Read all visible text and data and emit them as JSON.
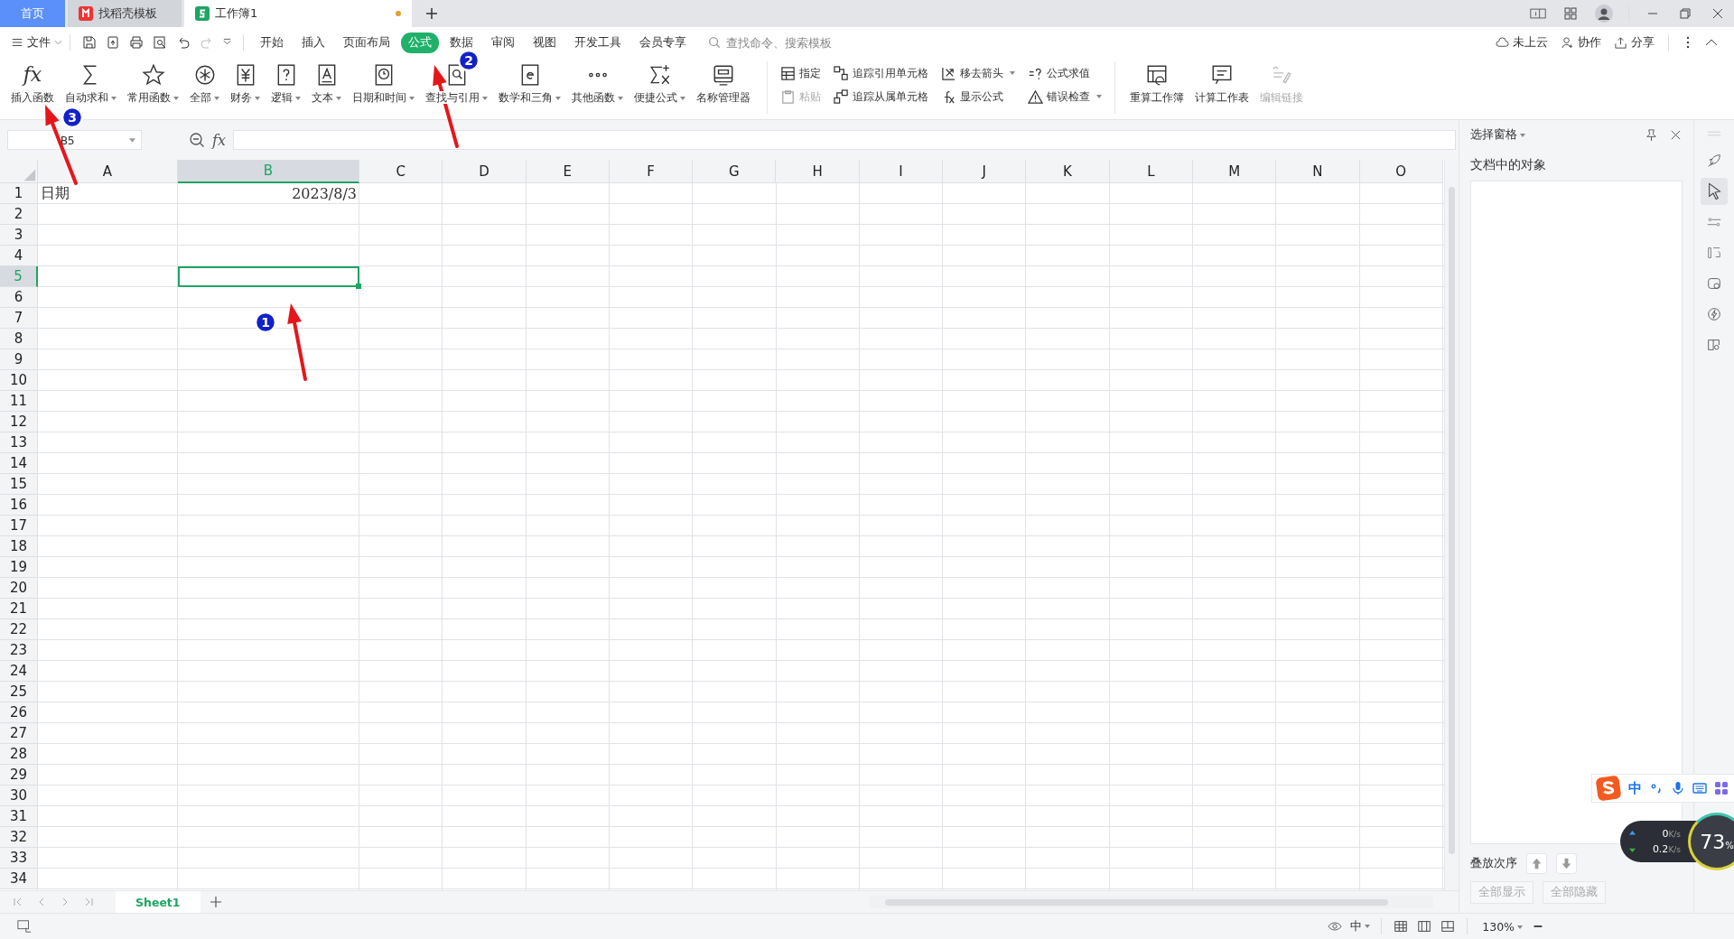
{
  "tabs": [
    {
      "label": "首页",
      "kind": "home",
      "selected": false,
      "modified": false
    },
    {
      "label": "找稻壳模板",
      "kind": "docer",
      "selected": false,
      "modified": false
    },
    {
      "label": "工作簿1",
      "kind": "sheet",
      "selected": true,
      "modified": true
    }
  ],
  "menu": {
    "file": "文件",
    "tabs": [
      {
        "label": "开始",
        "selected": false
      },
      {
        "label": "插入",
        "selected": false
      },
      {
        "label": "页面布局",
        "selected": false
      },
      {
        "label": "公式",
        "selected": true
      },
      {
        "label": "数据",
        "selected": false
      },
      {
        "label": "审阅",
        "selected": false
      },
      {
        "label": "视图",
        "selected": false
      },
      {
        "label": "开发工具",
        "selected": false
      },
      {
        "label": "会员专享",
        "selected": false
      }
    ],
    "search": {
      "placeholder": "查找命令、搜索模板"
    },
    "actions": [
      "未上云",
      "协作",
      "分享"
    ]
  },
  "ribbon": {
    "large": [
      {
        "label": "插入函数",
        "glyph": "fx",
        "dropdown": false
      },
      {
        "label": "自动求和",
        "dropdown": true
      },
      {
        "label": "常用函数",
        "dropdown": true
      },
      {
        "label": "全部",
        "dropdown": true
      },
      {
        "label": "财务",
        "dropdown": true
      },
      {
        "label": "逻辑",
        "dropdown": true
      },
      {
        "label": "文本",
        "dropdown": true
      },
      {
        "label": "日期和时间",
        "dropdown": true
      },
      {
        "label": "查找与引用",
        "dropdown": true
      },
      {
        "label": "数学和三角",
        "dropdown": true
      },
      {
        "label": "其他函数",
        "dropdown": true
      },
      {
        "label": "便捷公式",
        "dropdown": true
      },
      {
        "label": "名称管理器",
        "dropdown": false
      }
    ],
    "small": [
      {
        "label": "指定",
        "disabled": false,
        "dropdown": false
      },
      {
        "label": "粘贴",
        "disabled": true,
        "dropdown": false
      },
      {
        "label": "追踪引用单元格",
        "disabled": false,
        "dropdown": false
      },
      {
        "label": "追踪从属单元格",
        "disabled": false,
        "dropdown": false
      },
      {
        "label": "移去箭头",
        "disabled": false,
        "dropdown": true
      },
      {
        "label": "显示公式",
        "disabled": false,
        "dropdown": false
      },
      {
        "label": "公式求值",
        "disabled": false,
        "dropdown": false
      },
      {
        "label": "错误检查",
        "disabled": false,
        "dropdown": true
      }
    ],
    "calc": [
      {
        "label": "重算工作簿",
        "disabled": false
      },
      {
        "label": "计算工作表",
        "disabled": false
      },
      {
        "label": "编辑链接",
        "disabled": true
      }
    ]
  },
  "formula_bar": {
    "name_box": "B5",
    "fx_label": "fx"
  },
  "sheet": {
    "columns": [
      {
        "label": "A",
        "selected": false
      },
      {
        "label": "B",
        "selected": true
      },
      {
        "label": "C",
        "selected": false
      },
      {
        "label": "D",
        "selected": false
      },
      {
        "label": "E",
        "selected": false
      },
      {
        "label": "F",
        "selected": false
      },
      {
        "label": "G",
        "selected": false
      },
      {
        "label": "H",
        "selected": false
      },
      {
        "label": "I",
        "selected": false
      },
      {
        "label": "J",
        "selected": false
      },
      {
        "label": "K",
        "selected": false
      },
      {
        "label": "L",
        "selected": false
      },
      {
        "label": "M",
        "selected": false
      },
      {
        "label": "N",
        "selected": false
      },
      {
        "label": "O",
        "selected": false
      }
    ],
    "rows": [
      {
        "label": "1",
        "selected": false,
        "cells": [
          {
            "text": "日期",
            "kind": "text"
          },
          {
            "text": "2023/8/3",
            "kind": "date"
          }
        ]
      },
      {
        "label": "2",
        "selected": false
      },
      {
        "label": "3",
        "selected": false
      },
      {
        "label": "4",
        "selected": false
      },
      {
        "label": "5",
        "selected": true
      },
      {
        "label": "6",
        "selected": false
      },
      {
        "label": "7",
        "selected": false
      },
      {
        "label": "8",
        "selected": false
      },
      {
        "label": "9",
        "selected": false
      },
      {
        "label": "10",
        "selected": false
      },
      {
        "label": "11",
        "selected": false
      },
      {
        "label": "12",
        "selected": false
      },
      {
        "label": "13",
        "selected": false
      },
      {
        "label": "14",
        "selected": false
      },
      {
        "label": "15",
        "selected": false
      },
      {
        "label": "16",
        "selected": false
      },
      {
        "label": "17",
        "selected": false
      },
      {
        "label": "18",
        "selected": false
      },
      {
        "label": "19",
        "selected": false
      },
      {
        "label": "20",
        "selected": false
      },
      {
        "label": "21",
        "selected": false
      },
      {
        "label": "22",
        "selected": false
      },
      {
        "label": "23",
        "selected": false
      },
      {
        "label": "24",
        "selected": false
      },
      {
        "label": "25",
        "selected": false
      },
      {
        "label": "26",
        "selected": false
      },
      {
        "label": "27",
        "selected": false
      },
      {
        "label": "28",
        "selected": false
      },
      {
        "label": "29",
        "selected": false
      },
      {
        "label": "30",
        "selected": false
      },
      {
        "label": "31",
        "selected": false
      },
      {
        "label": "32",
        "selected": false
      },
      {
        "label": "33",
        "selected": false
      },
      {
        "label": "34",
        "selected": false
      }
    ]
  },
  "sheet_tabs": [
    {
      "label": "Sheet1",
      "selected": true
    }
  ],
  "selection_pane": {
    "title": "选择窗格",
    "heading": "文档中的对象",
    "order_label": "叠放次序",
    "buttons": [
      "全部显示",
      "全部隐藏"
    ]
  },
  "status_bar": {
    "input_mode": "中",
    "zoom": "130%"
  },
  "ime_bar": {
    "mode": "中"
  },
  "net_meter": {
    "upload": "0",
    "upload_unit": "K/s",
    "download": "0.2",
    "download_unit": "K/s",
    "usage": "73",
    "usage_unit": "%"
  },
  "annotations": [
    {
      "number": "1"
    },
    {
      "number": "2"
    },
    {
      "number": "3"
    }
  ]
}
